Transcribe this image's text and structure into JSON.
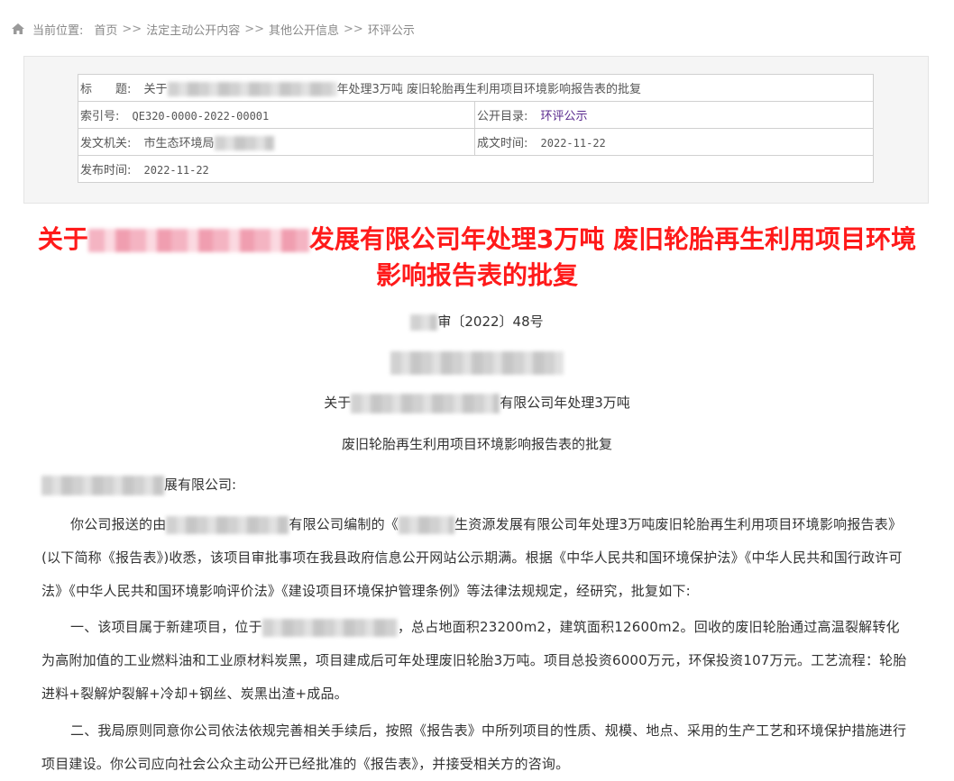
{
  "breadcrumb": {
    "label": "当前位置:",
    "items": [
      "首页",
      "法定主动公开内容",
      "其他公开信息",
      "环评公示"
    ],
    "separator": ">>"
  },
  "meta": {
    "title_label": "标　　题:",
    "title_prefix": "关于",
    "title_suffix": "年处理3万吨 废旧轮胎再生利用项目环境影响报告表的批复",
    "index_label": "索引号:",
    "index_value": "QE320-0000-2022-00001",
    "catalog_label": "公开目录:",
    "catalog_value": "环评公示",
    "issuer_label": "发文机关:",
    "issuer_value": "市生态环境局",
    "date_made_label": "成文时间:",
    "date_made_value": "2022-11-22",
    "publish_label": "发布时间:",
    "publish_value": "2022-11-22"
  },
  "doc": {
    "title_prefix": "关于",
    "title_rest": "发展有限公司年处理3万吨 废旧轮胎再生利用项目环境影响报告表的批复",
    "doc_number_suffix": "审〔2022〕48号",
    "subject_prefix": "关于",
    "subject_suffix": "有限公司年处理3万吨",
    "subject_line2": "废旧轮胎再生利用项目环境影响报告表的批复",
    "salutation_suffix": "展有限公司:",
    "p1_a": "你公司报送的由",
    "p1_b": "有限公司编制的《",
    "p1_c": "生资源发展有限公司年处理3万吨废旧轮胎再生利用项目环境影响报告表》(以下简称《报告表》)收悉，该项目审批事项在我县政府信息公开网站公示期满。根据《中华人民共和国环境保护法》《中华人民共和国行政许可法》《中华人民共和国环境影响评价法》《建设项目环境保护管理条例》等法律法规规定，经研究，批复如下:",
    "p2_a": "一、该项目属于新建项目，位于",
    "p2_b": "，总占地面积23200m2，建筑面积12600m2。回收的废旧轮胎通过高温裂解转化为高附加值的工业燃料油和工业原材料炭黑，项目建成后可年处理废旧轮胎3万吨。项目总投资6000万元，环保投资107万元。工艺流程：轮胎进料+裂解炉裂解+冷却+钢丝、炭黑出渣+成品。",
    "p3": "二、我局原则同意你公司依法依规完善相关手续后，按照《报告表》中所列项目的性质、规模、地点、采用的生产工艺和环境保护措施进行项目建设。你公司应向社会公众主动公开已经批准的《报告表》，并接受相关方的咨询。"
  },
  "colors": {
    "title": "#ff1a1a",
    "link": "#5a2a8e",
    "muted": "#888888"
  },
  "icons": {
    "home": "home-icon"
  }
}
